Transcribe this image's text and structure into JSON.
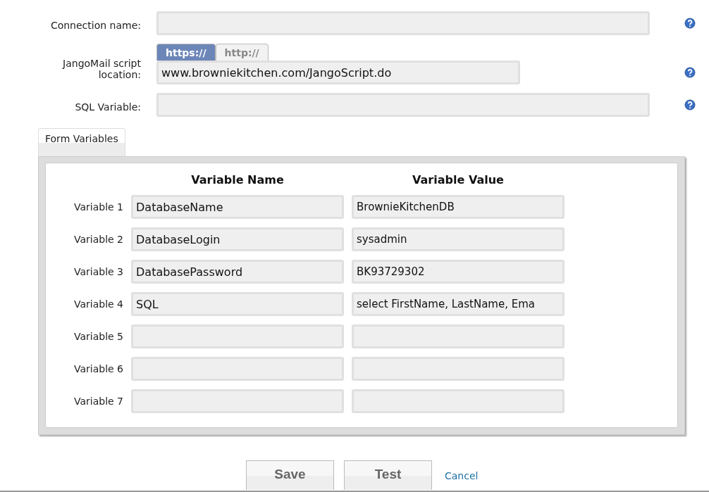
{
  "fields": [
    {
      "kind": "text",
      "label": "Connection name:"
    },
    {
      "kind": "url",
      "label": "JangoMail script location:",
      "value": "www.browniekitchen.com/JangoScript.do",
      "protocols": [
        {
          "label": "https://",
          "selected": true
        },
        {
          "label": "http://",
          "selected": false
        }
      ]
    },
    {
      "kind": "text",
      "label": "SQL Variable:"
    }
  ],
  "section_tabs": [
    {
      "label": "Form Variables",
      "selected": true
    }
  ],
  "variables": {
    "columns": [
      "Variable Name",
      "Variable Value"
    ],
    "rows": [
      {
        "label": "Variable 1",
        "name": "DatabaseName",
        "value": "BrownieKitchenDB"
      },
      {
        "label": "Variable 2",
        "name": "DatabaseLogin",
        "value": "sysadmin"
      },
      {
        "label": "Variable 3",
        "name": "DatabasePassword",
        "value": "BK93729302"
      },
      {
        "label": "Variable 4",
        "name": "SQL",
        "value": "select FirstName, LastName, Ema"
      },
      {
        "label": "Variable 5"
      },
      {
        "label": "Variable 6"
      },
      {
        "label": "Variable 7"
      }
    ]
  },
  "buttons": [
    {
      "kind": "button",
      "label": "Save"
    },
    {
      "kind": "button",
      "label": "Test"
    },
    {
      "kind": "link",
      "label": "Cancel"
    }
  ]
}
